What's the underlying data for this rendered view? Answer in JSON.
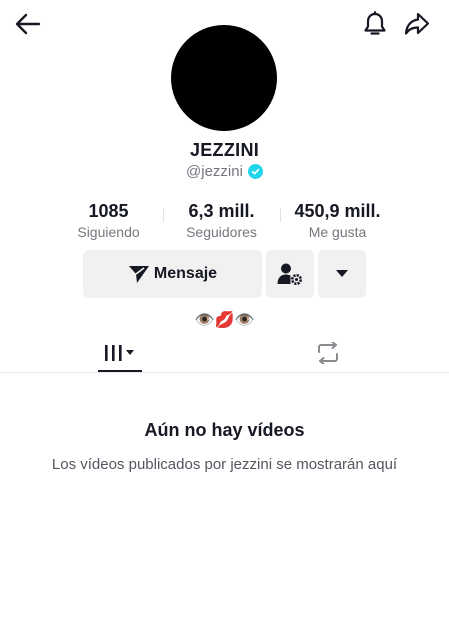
{
  "header": {
    "back_icon": "arrow-left-icon",
    "bell_icon": "bell-icon",
    "share_icon": "share-arrow-icon"
  },
  "profile": {
    "display_name": "JEZZINI",
    "handle": "@jezzini",
    "verified": true,
    "verified_color": "#20d5ec"
  },
  "stats": [
    {
      "value": "1085",
      "label": "Siguiendo"
    },
    {
      "value": "6,3 mill.",
      "label": "Seguidores"
    },
    {
      "value": "450,9 mill.",
      "label": "Me gusta"
    }
  ],
  "actions": {
    "message_label": "Mensaje",
    "message_icon": "send-icon",
    "user_settings_icon": "user-gear-icon",
    "more_icon": "caret-down-icon"
  },
  "bio": "👁️💋👁️",
  "tabs": {
    "videos_icon": "videos-grid-icon",
    "reposts_icon": "repost-icon"
  },
  "empty_state": {
    "title": "Aún no hay vídeos",
    "subtitle": "Los vídeos publicados por jezzini se mostrarán aquí"
  }
}
